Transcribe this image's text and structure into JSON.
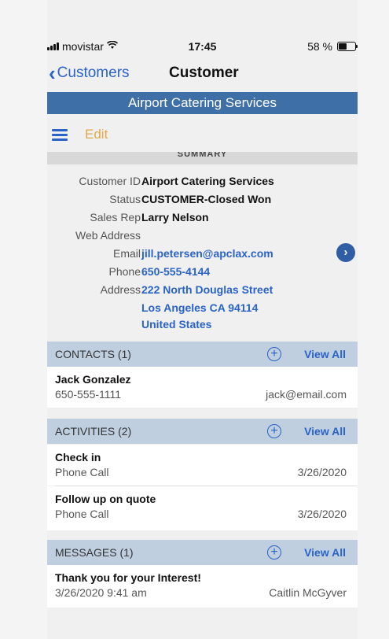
{
  "status_bar": {
    "carrier": "movistar",
    "time": "17:45",
    "battery_text": "58 %",
    "battery_level": 0.58
  },
  "nav": {
    "back_label": "Customers",
    "title": "Customer"
  },
  "banner": "Airport Catering Services",
  "toolbar": {
    "edit_label": "Edit"
  },
  "summary": {
    "header": "SUMMARY",
    "fields": [
      {
        "label": "Customer ID",
        "value": "Airport Catering Services"
      },
      {
        "label": "Status",
        "value": "CUSTOMER-Closed Won"
      },
      {
        "label": "Sales Rep",
        "value": "Larry Nelson"
      },
      {
        "label": "Web Address",
        "value": ""
      },
      {
        "label": "Email",
        "value": "jill.petersen@apclax.com"
      },
      {
        "label": "Phone",
        "value": "650-555-4144"
      },
      {
        "label": "Address",
        "value": "222 North Douglas Street"
      }
    ],
    "address_line2": "Los Angeles CA 94114",
    "address_line3": "United States"
  },
  "contacts": {
    "header": "CONTACTS (1)",
    "view_all": "View All",
    "items": [
      {
        "name": "Jack Gonzalez",
        "phone": "650-555-1111",
        "email": "jack@email.com"
      }
    ]
  },
  "activities": {
    "header": "ACTIVITIES (2)",
    "view_all": "View All",
    "items": [
      {
        "title": "Check in",
        "type": "Phone Call",
        "date": "3/26/2020"
      },
      {
        "title": "Follow up on quote",
        "type": "Phone Call",
        "date": "3/26/2020"
      }
    ]
  },
  "messages": {
    "header": "MESSAGES (1)",
    "view_all": "View All",
    "items": [
      {
        "title": "Thank you for your Interest!",
        "datetime": "3/26/2020 9:41 am",
        "from": "Caitlin McGyver"
      }
    ]
  },
  "icons": {
    "back": "chevron-left-icon",
    "menu": "hamburger-menu-icon",
    "detail": "chevron-right-circle-icon",
    "add": "plus-circle-icon"
  },
  "colors": {
    "accent": "#2a63c6",
    "banner": "#3e6fa6",
    "section_header": "#bfcfe0",
    "edit": "#e0a94a"
  }
}
